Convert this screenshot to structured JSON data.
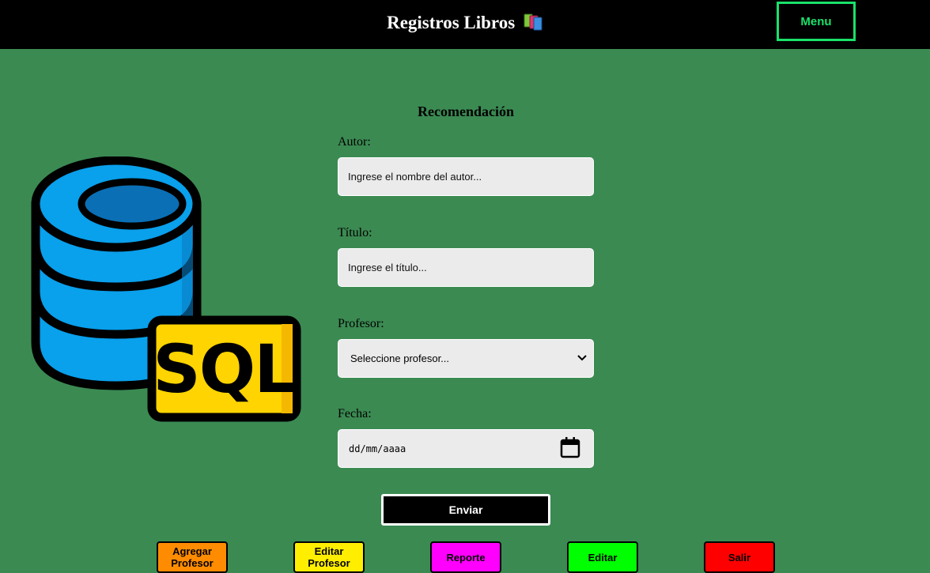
{
  "header": {
    "title": "Registros Libros",
    "books_icon": "books-icon",
    "menu_label": "Menu",
    "menu_color": "#19e26a"
  },
  "illustration": {
    "icon": "database-sql-icon",
    "text": "SQL"
  },
  "form": {
    "heading": "Recomendación",
    "author_label": "Autor:",
    "author_placeholder": "Ingrese el nombre del autor...",
    "title_label": "Título:",
    "title_placeholder": "Ingrese el título...",
    "teacher_label": "Profesor:",
    "teacher_selected": "Seleccione profesor...",
    "date_label": "Fecha:",
    "date_placeholder": "dd/mm/aaaa",
    "submit_label": "Enviar"
  },
  "nav": [
    {
      "label": "Agregar Profesor",
      "color": "#ff8c00"
    },
    {
      "label": "Editar Profesor",
      "color": "#ffee00"
    },
    {
      "label": "Reporte",
      "color": "#ff00ff"
    },
    {
      "label": "Editar",
      "color": "#00ff00"
    },
    {
      "label": "Salir",
      "color": "#ff0000"
    }
  ],
  "colors": {
    "page_background": "#3b8a52",
    "header_background": "#000000"
  }
}
